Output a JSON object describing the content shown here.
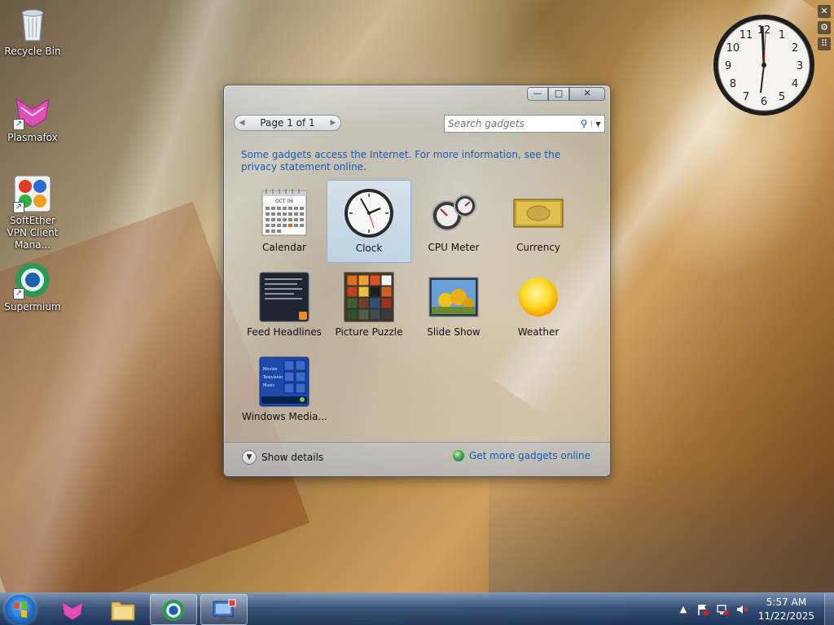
{
  "desktop": {
    "icons": [
      {
        "label": "Recycle Bin",
        "icon": "recycle-bin-icon"
      },
      {
        "label": "Plasmafox",
        "icon": "plasmafox-icon"
      },
      {
        "label": "SoftEther VPN Client Mana...",
        "icon": "softether-vpn-icon"
      },
      {
        "label": "Supermium",
        "icon": "supermium-icon"
      }
    ]
  },
  "gallery": {
    "window_controls": {
      "minimize": "—",
      "maximize": "□",
      "close": "✕"
    },
    "pager_text": "Page 1 of 1",
    "search_placeholder": "Search gadgets",
    "notice": "Some gadgets access the Internet.  For more information, see the privacy statement online.",
    "gadgets": [
      {
        "label": "Calendar",
        "selected": false
      },
      {
        "label": "Clock",
        "selected": true
      },
      {
        "label": "CPU Meter",
        "selected": false
      },
      {
        "label": "Currency",
        "selected": false
      },
      {
        "label": "Feed Headlines",
        "selected": false
      },
      {
        "label": "Picture Puzzle",
        "selected": false
      },
      {
        "label": "Slide Show",
        "selected": false
      },
      {
        "label": "Weather",
        "selected": false
      },
      {
        "label": "Windows Media...",
        "selected": false
      }
    ],
    "calendar_month": "OCT 06",
    "media_lines": [
      "Movies",
      "Television",
      "Music"
    ],
    "show_details": "Show details",
    "more_online": "Get more gadgets online"
  },
  "desktop_clock": {
    "numbers": [
      "12",
      "1",
      "2",
      "3",
      "4",
      "5",
      "6",
      "7",
      "8",
      "9",
      "10",
      "11"
    ]
  },
  "taskbar": {
    "pinned": [
      {
        "name": "plasmafox",
        "active": false
      },
      {
        "name": "file-explorer",
        "active": false
      },
      {
        "name": "supermium",
        "active": true
      },
      {
        "name": "gadgets-desktop",
        "active": true
      }
    ],
    "time": "5:57 AM",
    "date": "11/22/2025"
  },
  "colors": {
    "link_blue": "#1a5bb8",
    "taskbar_top": "#7896be",
    "taskbar_bottom": "#19325a"
  }
}
